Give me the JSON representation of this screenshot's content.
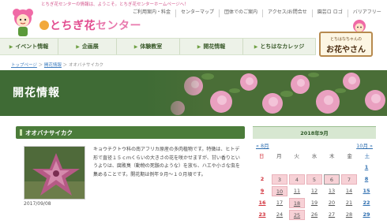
{
  "top_bar": {
    "text": "とちぎ花センターの情報は、ようこそ。とちぎ花センターホームページへ！"
  },
  "header": {
    "logo_text_hana": "とちぎ花",
    "logo_text_rest": "センター",
    "links": [
      "ご利用案内・料金",
      "センターマップ",
      "団体でのご案内",
      "アクセス/お問合せ",
      "園芸ロ ロゴ",
      "バリアフリー"
    ]
  },
  "nav": {
    "items": [
      "イベント情報",
      "企画展",
      "体験教室",
      "開花情報",
      "とちはなカレッジ"
    ]
  },
  "hana_card": {
    "small": "とちはなちゃんの",
    "big": "お花やさん"
  },
  "breadcrumb": {
    "home": "トップページ",
    "sep1": "＞",
    "section": "開花情報",
    "sep2": "＞",
    "current": "オオバナサイカク"
  },
  "hero": {
    "title": "開花情報"
  },
  "article": {
    "title": "オオバナサイカク",
    "date": "2017/09/08",
    "body": "キョウチクトウ科の南アフリカ原産の多肉植物です。特徴は、ヒトデ形で直径１５ｃｍくらいの大きさの花を咲かせますが、甘い香りというよりは、腐敗臭（動物の死骸のような）を放ち、ハエや小さな虫を集めることです。開花期は例年９月～１０月頃です。"
  },
  "calendar": {
    "title": "2018年9月",
    "prev": "« 8月",
    "next": "10月 »",
    "dow": [
      "日",
      "月",
      "火",
      "水",
      "木",
      "金",
      "土"
    ],
    "weeks": [
      [
        {
          "d": ""
        },
        {
          "d": ""
        },
        {
          "d": ""
        },
        {
          "d": ""
        },
        {
          "d": ""
        },
        {
          "d": ""
        },
        {
          "d": "1",
          "cls": "sat link"
        }
      ],
      [
        {
          "d": "2",
          "cls": "sun"
        },
        {
          "d": "3",
          "cls": "has"
        },
        {
          "d": "4",
          "cls": "has"
        },
        {
          "d": "5",
          "cls": "has"
        },
        {
          "d": "6",
          "cls": "has today"
        },
        {
          "d": "7",
          "cls": "has"
        },
        {
          "d": "8",
          "cls": "sat link"
        }
      ],
      [
        {
          "d": "9",
          "cls": "sun link"
        },
        {
          "d": "10",
          "cls": "has link"
        },
        {
          "d": "11",
          "cls": "link"
        },
        {
          "d": "12",
          "cls": "link"
        },
        {
          "d": "13",
          "cls": "link"
        },
        {
          "d": "14",
          "cls": "link"
        },
        {
          "d": "15",
          "cls": "sat link"
        }
      ],
      [
        {
          "d": "16",
          "cls": "sun link"
        },
        {
          "d": "17",
          "cls": "link"
        },
        {
          "d": "18",
          "cls": "has link"
        },
        {
          "d": "19",
          "cls": "link"
        },
        {
          "d": "20",
          "cls": "link"
        },
        {
          "d": "21",
          "cls": "link"
        },
        {
          "d": "22",
          "cls": "sat link"
        }
      ],
      [
        {
          "d": "23",
          "cls": "sun link"
        },
        {
          "d": "24",
          "cls": "link"
        },
        {
          "d": "25",
          "cls": "has link"
        },
        {
          "d": "26",
          "cls": "link"
        },
        {
          "d": "27",
          "cls": "link"
        },
        {
          "d": "28",
          "cls": "link"
        },
        {
          "d": "29",
          "cls": "sat link"
        }
      ]
    ]
  },
  "colors": {
    "brand_pink": "#e24b8f",
    "nav_green": "#3a5a2a",
    "hero_green": "#3f6b35",
    "calendar_highlight": "#f7d1d6"
  },
  "icons": [
    "mascot-icon",
    "flower-logo-icon",
    "link-icon",
    "hana-mascot-icon"
  ]
}
